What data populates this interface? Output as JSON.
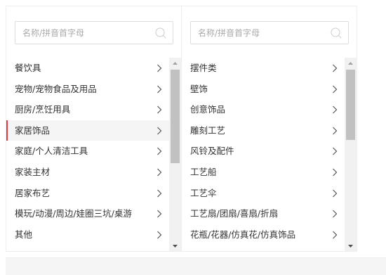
{
  "left_panel": {
    "search_placeholder": "名称/拼音首字母",
    "items": [
      {
        "label": "餐饮具"
      },
      {
        "label": "宠物/宠物食品及用品"
      },
      {
        "label": "厨房/烹饪用具"
      },
      {
        "label": "家居饰品",
        "selected": true
      },
      {
        "label": "家庭/个人清洁工具"
      },
      {
        "label": "家装主材"
      },
      {
        "label": "居家布艺"
      },
      {
        "label": "模玩/动漫/周边/娃圈三坑/桌游"
      },
      {
        "label": "其他"
      }
    ]
  },
  "right_panel": {
    "search_placeholder": "名称/拼音首字母",
    "items": [
      {
        "label": "摆件类"
      },
      {
        "label": "壁饰"
      },
      {
        "label": "创意饰品"
      },
      {
        "label": "雕刻工艺"
      },
      {
        "label": "风铃及配件"
      },
      {
        "label": "工艺船"
      },
      {
        "label": "工艺伞"
      },
      {
        "label": "工艺扇/团扇/喜扇/折扇"
      },
      {
        "label": "花瓶/花器/仿真花/仿真饰品"
      }
    ]
  },
  "icons": {
    "search": "search-icon",
    "chevron": "chevron-right-icon",
    "scroll_up": "scroll-up-arrow-icon",
    "scroll_down": "scroll-down-arrow-icon"
  },
  "colors": {
    "selected_accent": "#e4393c",
    "selected_bg": "#f5f5f5",
    "placeholder": "#aaaaaa",
    "scroll_thumb": "#c1c1c1"
  }
}
